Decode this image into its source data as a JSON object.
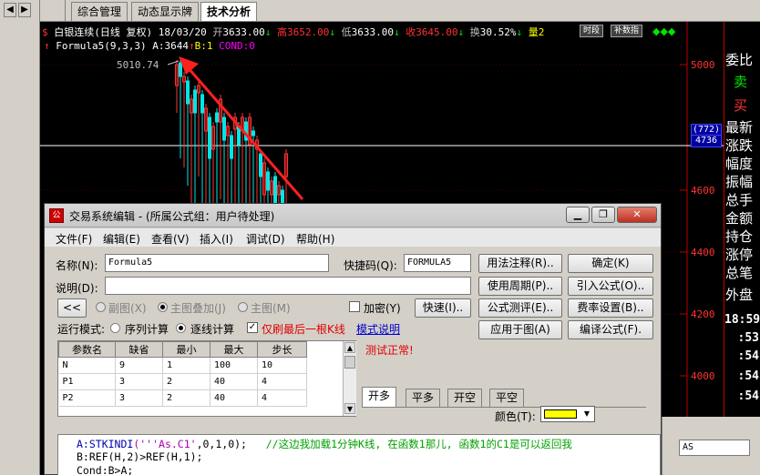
{
  "tabs": [
    "综合管理",
    "动态显示牌",
    "技术分析"
  ],
  "nav_arrows": [
    "◀",
    "▶"
  ],
  "chart_header": {
    "symbol": "白银连续(日线 复权) 18/03/20",
    "open_label": "开",
    "open": "3633.00",
    "high_label": "高",
    "high": "3652.00",
    "low_label": "低",
    "low": "3633.00",
    "close_label": "收",
    "close": "3645.00",
    "turnover_label": "换",
    "turnover": "30.52%",
    "volume_label": "量",
    "volume": "2",
    "btn_period": "时段",
    "btn_data": "补数指"
  },
  "formula_line": {
    "name": "Formula5(9,3,3)",
    "a_label": "A:",
    "a_value": "3644",
    "b_label": "B:",
    "b_value": "1",
    "cond_label": "COND:",
    "cond_value": "0"
  },
  "high_label": "5010.74",
  "price_axis": [
    "5000",
    "4600",
    "4400",
    "4200",
    "4000"
  ],
  "price_box": [
    "(772)",
    "4736"
  ],
  "right_panel": {
    "items": [
      "委比",
      "卖",
      "买",
      "最新",
      "涨跌",
      "幅度",
      "振幅",
      "总手",
      "金额",
      "持仓",
      "涨停",
      "总笔",
      "外盘"
    ],
    "times": [
      "18:59",
      ":53",
      ":54",
      ":54",
      ":54"
    ]
  },
  "dialog": {
    "title": "交易系统编辑 - (所属公式组：用户待处理)",
    "window_buttons": [
      "▁",
      "❐",
      "✕"
    ],
    "menu": [
      "文件(F)",
      "编辑(E)",
      "查看(V)",
      "插入(I)",
      "调试(D)",
      "帮助(H)"
    ],
    "name_label": "名称(N):",
    "name_value": "Formula5",
    "hotkey_label": "快捷码(Q):",
    "hotkey_value": "FORMULA5",
    "desc_label": "说明(D):",
    "desc_value": "",
    "collapse_btn": "<<",
    "radio_sub": "副图(X)",
    "radio_overlay": "主图叠加(J)",
    "radio_main": "主图(M)",
    "encrypt_label": "加密(Y)",
    "fast_btn": "快速(I)..",
    "run_mode_label": "运行模式:",
    "mode_seq": "序列计算",
    "mode_bar": "逐线计算",
    "last_bar_label": "仅刷最后一根K线",
    "mode_help": "模式说明",
    "test_status": "测试正常!",
    "buttons_col1": [
      "用法注释(R)..",
      "使用周期(P)..",
      "公式测评(E)..",
      "应用于图(A)"
    ],
    "buttons_col2": [
      "确定(K)",
      "引入公式(O)..",
      "费率设置(B)..",
      "编译公式(F)."
    ],
    "param_headers": [
      "参数名",
      "缺省",
      "最小",
      "最大",
      "步长"
    ],
    "params": [
      [
        "N",
        "9",
        "1",
        "100",
        "10"
      ],
      [
        "P1",
        "3",
        "2",
        "40",
        "4"
      ],
      [
        "P2",
        "3",
        "2",
        "40",
        "4"
      ]
    ],
    "signal_tabs": [
      "开多",
      "平多",
      "开空",
      "平空"
    ],
    "color_label": "颜色(T):",
    "code": {
      "line1_a": "A:",
      "line1_fn": "STKINDI",
      "line1_args1": "(''",
      "line1_str1": "'As.C1'",
      "line1_args2": ",0,1,0);",
      "line1_comment": "//这边我加载1分钟K线, 在函数1那儿, 函数1的C1是可以返回我",
      "line2": "B:REF(H,2)>REF(H,1);",
      "line3": "Cond:B>A;"
    }
  },
  "side_field": "AS"
}
